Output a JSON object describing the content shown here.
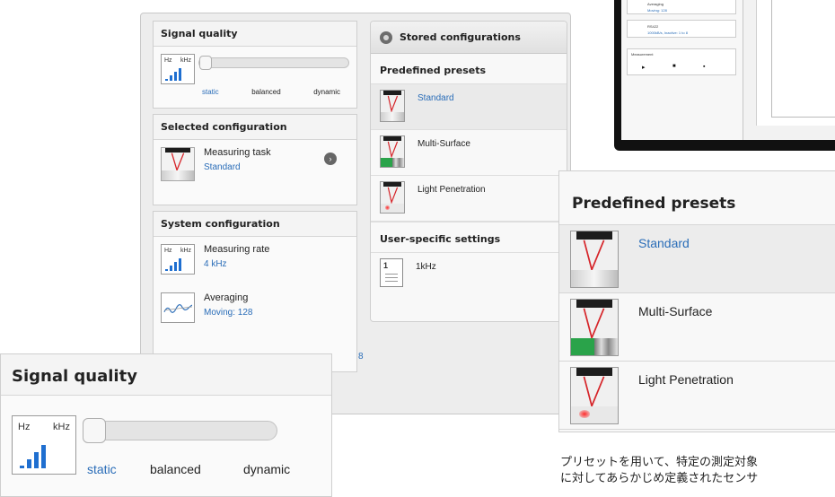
{
  "signal_quality": {
    "title": "Signal quality",
    "hz": "Hz",
    "khz": "kHz",
    "labels": [
      "static",
      "balanced",
      "dynamic"
    ]
  },
  "selected_configuration": {
    "title": "Selected configuration",
    "task_label": "Measuring task",
    "task_value": "Standard"
  },
  "system_configuration": {
    "title": "System configuration",
    "rate_label": "Measuring rate",
    "rate_value": "4 kHz",
    "averaging_label": "Averaging",
    "averaging_value": "Moving: 128",
    "partial_value": "8"
  },
  "stored_configurations": {
    "title": "Stored configurations",
    "predefined_title": "Predefined presets",
    "presets": [
      "Standard",
      "Multi-Surface",
      "Light Penetration"
    ],
    "user_title": "User-specific settings",
    "user_items": [
      {
        "icon_text": "1",
        "label": "1kHz"
      }
    ]
  },
  "dark_screenshot": {
    "averaging_label": "Averaging",
    "averaging_value": "Moving: 128",
    "rs422_label": "RS422",
    "rs422_value": "1000kB/s, Inactive: 1 to 8",
    "measurement_label": "Measurement",
    "controls": [
      "▸",
      "■",
      "▪"
    ]
  },
  "japanese_caption": [
    "プリセットを用いて、特定の測定対象",
    "に対してあらかじめ定義されたセンサ"
  ],
  "colors": {
    "accent": "#2a6db8",
    "laser": "#d6252a",
    "green": "#2aa34a"
  }
}
